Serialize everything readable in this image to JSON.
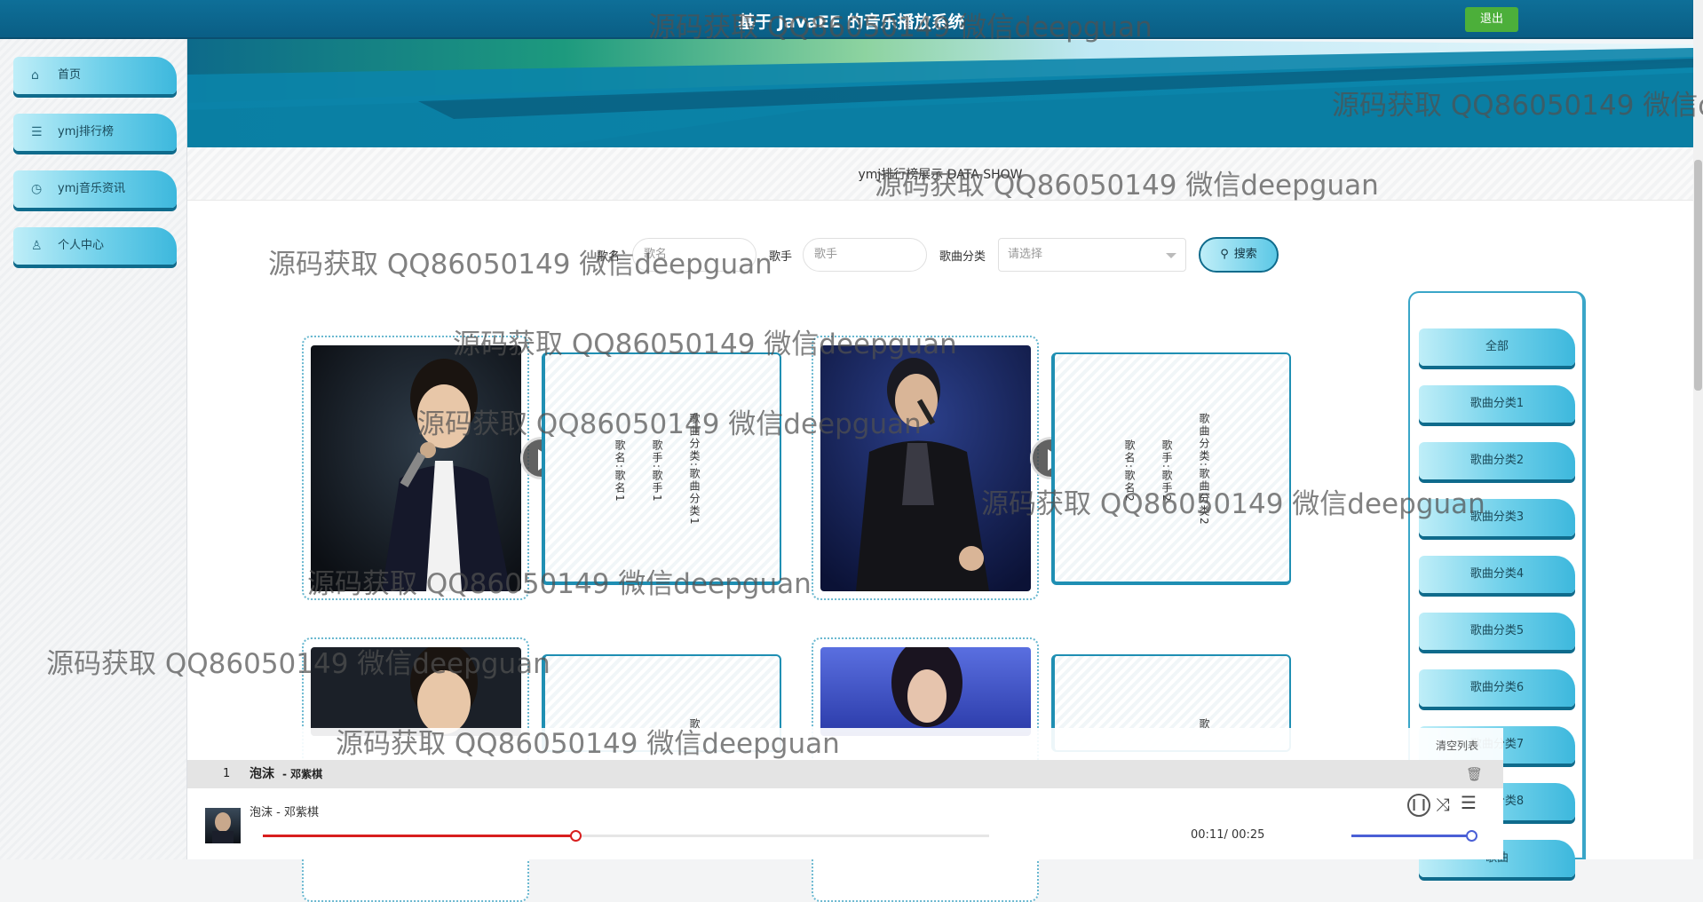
{
  "header": {
    "title": "基于 JavaEE 的音乐播放系统",
    "logout_label": "退出"
  },
  "sidebar": {
    "items": [
      {
        "label": "首页",
        "icon": "home-icon"
      },
      {
        "label": "ymj排行榜",
        "icon": "sliders-icon"
      },
      {
        "label": "ymj音乐资讯",
        "icon": "clock-icon"
      },
      {
        "label": "个人中心",
        "icon": "user-icon"
      }
    ]
  },
  "section": {
    "title": "ymj排行榜展示 DATA SHOW"
  },
  "search": {
    "song_label": "歌名",
    "song_placeholder": "歌名",
    "singer_label": "歌手",
    "singer_placeholder": "歌手",
    "category_label": "歌曲分类",
    "category_value": "请选择",
    "button_label": "搜索"
  },
  "songs": [
    {
      "name_text": "歌名:歌名1",
      "singer_text": "歌手:歌手1",
      "category_text": "歌曲分类:歌曲分类1"
    },
    {
      "name_text": "歌名:歌名2",
      "singer_text": "歌手:歌手2",
      "category_text": "歌曲分类:歌曲分类2"
    },
    {
      "category_text": "歌"
    },
    {
      "category_text": "歌"
    }
  ],
  "categories": [
    "全部",
    "歌曲分类1",
    "歌曲分类2",
    "歌曲分类3",
    "歌曲分类4",
    "歌曲分类5",
    "歌曲分类6",
    "歌曲分类7",
    "歌曲分类8",
    "歌曲"
  ],
  "player": {
    "clear_label": "清空列表",
    "playlist": [
      {
        "index": "1",
        "title": "泡沫",
        "artist": "- 邓紫棋"
      }
    ],
    "now_playing": "泡沫 - 邓紫棋",
    "time": "00:11/ 00:25",
    "progress": 0.43,
    "volume": 1.0,
    "colors": {
      "progress": "#d81e1e",
      "volume": "#4a5fd6"
    }
  },
  "watermark": "源码获取 QQ86050149 微信deepguan"
}
